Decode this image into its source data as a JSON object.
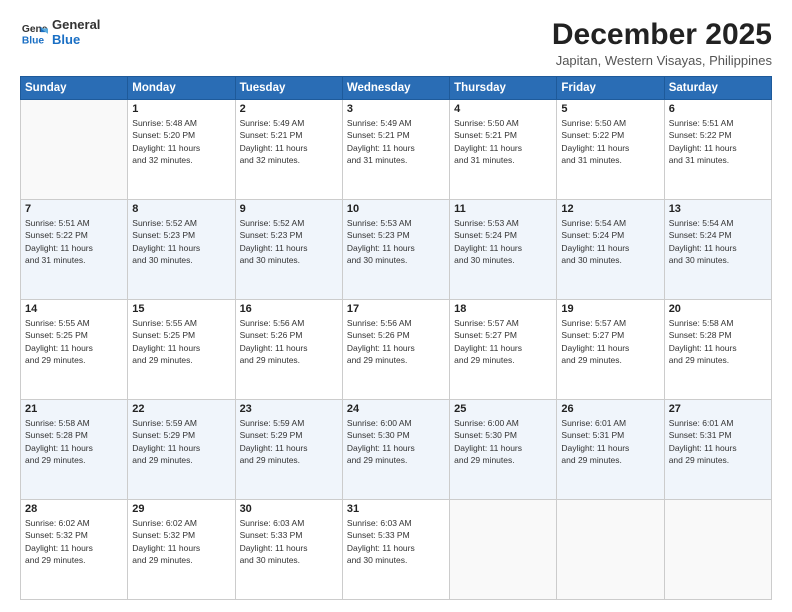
{
  "header": {
    "logo_line1": "General",
    "logo_line2": "Blue",
    "title": "December 2025",
    "subtitle": "Japitan, Western Visayas, Philippines"
  },
  "days_of_week": [
    "Sunday",
    "Monday",
    "Tuesday",
    "Wednesday",
    "Thursday",
    "Friday",
    "Saturday"
  ],
  "weeks": [
    [
      {
        "day": "",
        "info": ""
      },
      {
        "day": "1",
        "info": "Sunrise: 5:48 AM\nSunset: 5:20 PM\nDaylight: 11 hours\nand 32 minutes."
      },
      {
        "day": "2",
        "info": "Sunrise: 5:49 AM\nSunset: 5:21 PM\nDaylight: 11 hours\nand 32 minutes."
      },
      {
        "day": "3",
        "info": "Sunrise: 5:49 AM\nSunset: 5:21 PM\nDaylight: 11 hours\nand 31 minutes."
      },
      {
        "day": "4",
        "info": "Sunrise: 5:50 AM\nSunset: 5:21 PM\nDaylight: 11 hours\nand 31 minutes."
      },
      {
        "day": "5",
        "info": "Sunrise: 5:50 AM\nSunset: 5:22 PM\nDaylight: 11 hours\nand 31 minutes."
      },
      {
        "day": "6",
        "info": "Sunrise: 5:51 AM\nSunset: 5:22 PM\nDaylight: 11 hours\nand 31 minutes."
      }
    ],
    [
      {
        "day": "7",
        "info": "Sunrise: 5:51 AM\nSunset: 5:22 PM\nDaylight: 11 hours\nand 31 minutes."
      },
      {
        "day": "8",
        "info": "Sunrise: 5:52 AM\nSunset: 5:23 PM\nDaylight: 11 hours\nand 30 minutes."
      },
      {
        "day": "9",
        "info": "Sunrise: 5:52 AM\nSunset: 5:23 PM\nDaylight: 11 hours\nand 30 minutes."
      },
      {
        "day": "10",
        "info": "Sunrise: 5:53 AM\nSunset: 5:23 PM\nDaylight: 11 hours\nand 30 minutes."
      },
      {
        "day": "11",
        "info": "Sunrise: 5:53 AM\nSunset: 5:24 PM\nDaylight: 11 hours\nand 30 minutes."
      },
      {
        "day": "12",
        "info": "Sunrise: 5:54 AM\nSunset: 5:24 PM\nDaylight: 11 hours\nand 30 minutes."
      },
      {
        "day": "13",
        "info": "Sunrise: 5:54 AM\nSunset: 5:24 PM\nDaylight: 11 hours\nand 30 minutes."
      }
    ],
    [
      {
        "day": "14",
        "info": "Sunrise: 5:55 AM\nSunset: 5:25 PM\nDaylight: 11 hours\nand 29 minutes."
      },
      {
        "day": "15",
        "info": "Sunrise: 5:55 AM\nSunset: 5:25 PM\nDaylight: 11 hours\nand 29 minutes."
      },
      {
        "day": "16",
        "info": "Sunrise: 5:56 AM\nSunset: 5:26 PM\nDaylight: 11 hours\nand 29 minutes."
      },
      {
        "day": "17",
        "info": "Sunrise: 5:56 AM\nSunset: 5:26 PM\nDaylight: 11 hours\nand 29 minutes."
      },
      {
        "day": "18",
        "info": "Sunrise: 5:57 AM\nSunset: 5:27 PM\nDaylight: 11 hours\nand 29 minutes."
      },
      {
        "day": "19",
        "info": "Sunrise: 5:57 AM\nSunset: 5:27 PM\nDaylight: 11 hours\nand 29 minutes."
      },
      {
        "day": "20",
        "info": "Sunrise: 5:58 AM\nSunset: 5:28 PM\nDaylight: 11 hours\nand 29 minutes."
      }
    ],
    [
      {
        "day": "21",
        "info": "Sunrise: 5:58 AM\nSunset: 5:28 PM\nDaylight: 11 hours\nand 29 minutes."
      },
      {
        "day": "22",
        "info": "Sunrise: 5:59 AM\nSunset: 5:29 PM\nDaylight: 11 hours\nand 29 minutes."
      },
      {
        "day": "23",
        "info": "Sunrise: 5:59 AM\nSunset: 5:29 PM\nDaylight: 11 hours\nand 29 minutes."
      },
      {
        "day": "24",
        "info": "Sunrise: 6:00 AM\nSunset: 5:30 PM\nDaylight: 11 hours\nand 29 minutes."
      },
      {
        "day": "25",
        "info": "Sunrise: 6:00 AM\nSunset: 5:30 PM\nDaylight: 11 hours\nand 29 minutes."
      },
      {
        "day": "26",
        "info": "Sunrise: 6:01 AM\nSunset: 5:31 PM\nDaylight: 11 hours\nand 29 minutes."
      },
      {
        "day": "27",
        "info": "Sunrise: 6:01 AM\nSunset: 5:31 PM\nDaylight: 11 hours\nand 29 minutes."
      }
    ],
    [
      {
        "day": "28",
        "info": "Sunrise: 6:02 AM\nSunset: 5:32 PM\nDaylight: 11 hours\nand 29 minutes."
      },
      {
        "day": "29",
        "info": "Sunrise: 6:02 AM\nSunset: 5:32 PM\nDaylight: 11 hours\nand 29 minutes."
      },
      {
        "day": "30",
        "info": "Sunrise: 6:03 AM\nSunset: 5:33 PM\nDaylight: 11 hours\nand 30 minutes."
      },
      {
        "day": "31",
        "info": "Sunrise: 6:03 AM\nSunset: 5:33 PM\nDaylight: 11 hours\nand 30 minutes."
      },
      {
        "day": "",
        "info": ""
      },
      {
        "day": "",
        "info": ""
      },
      {
        "day": "",
        "info": ""
      }
    ]
  ]
}
